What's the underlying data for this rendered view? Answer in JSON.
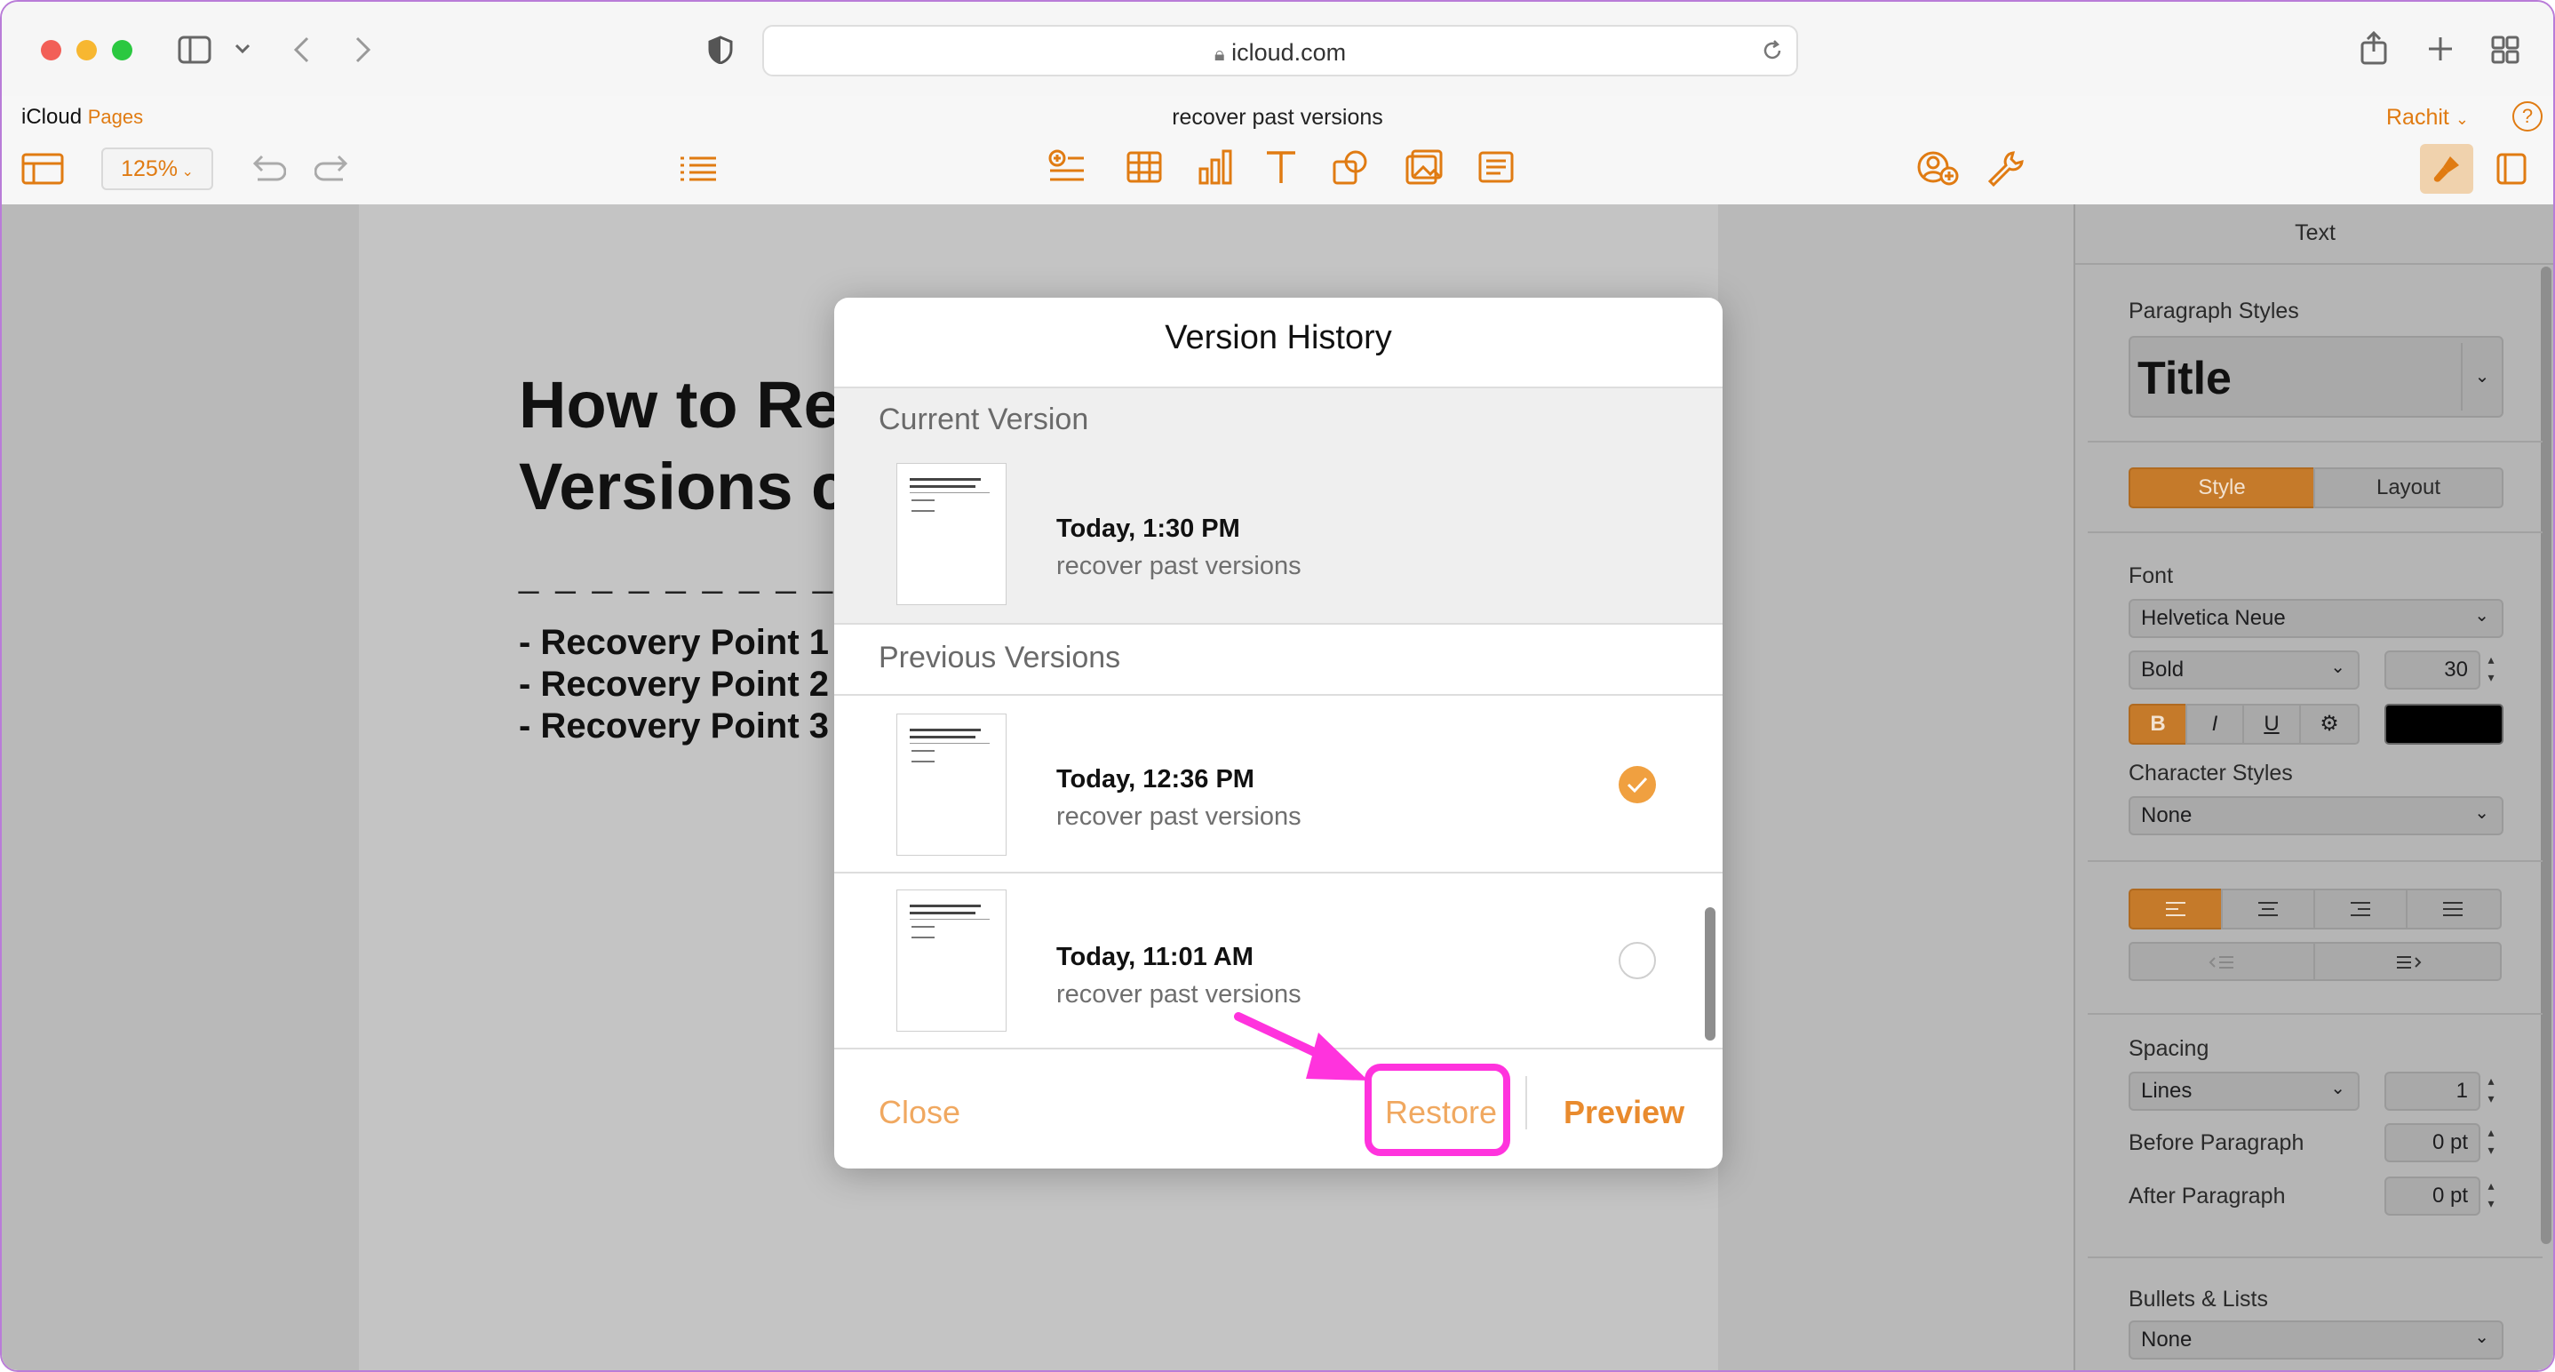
{
  "browser": {
    "url": "icloud.com",
    "lock_icon": "lock-icon",
    "reload_icon": "reload-icon"
  },
  "app": {
    "brand": "iCloud",
    "app_name": "Pages",
    "doc_title": "recover past versions",
    "user": "Rachit",
    "help": "?",
    "zoom": "125%"
  },
  "document": {
    "title": "How to Re\nVersions c",
    "dashes": "_ _ _ _ _ _ _ _ _ _ _ _ _",
    "items": [
      "-  Recovery Point 1",
      "-  Recovery Point 2",
      "-  Recovery Point 3"
    ]
  },
  "sidebar": {
    "header": "Text",
    "paragraph_styles_label": "Paragraph Styles",
    "paragraph_style": "Title",
    "tab_style": "Style",
    "tab_layout": "Layout",
    "font_label": "Font",
    "font_family": "Helvetica Neue",
    "font_weight": "Bold",
    "font_size": "30",
    "bold": "B",
    "italic": "I",
    "underline": "U",
    "gear": "⚙︎",
    "char_styles_label": "Character Styles",
    "char_style": "None",
    "spacing_label": "Spacing",
    "spacing_mode": "Lines",
    "spacing_value": "1",
    "before_label": "Before Paragraph",
    "before_value": "0 pt",
    "after_label": "After Paragraph",
    "after_value": "0 pt",
    "bullets_label": "Bullets & Lists",
    "bullets_value": "None"
  },
  "modal": {
    "title": "Version History",
    "current_label": "Current Version",
    "previous_label": "Previous Versions",
    "current": {
      "time": "Today, 1:30 PM",
      "name": "recover past versions"
    },
    "previous": [
      {
        "time": "Today, 12:36 PM",
        "name": "recover past versions",
        "selected": true
      },
      {
        "time": "Today, 11:01 AM",
        "name": "recover past versions",
        "selected": false
      }
    ],
    "close": "Close",
    "restore": "Restore",
    "preview": "Preview"
  },
  "colors": {
    "accent": "#e07b12",
    "annotation": "#ff33dd"
  }
}
